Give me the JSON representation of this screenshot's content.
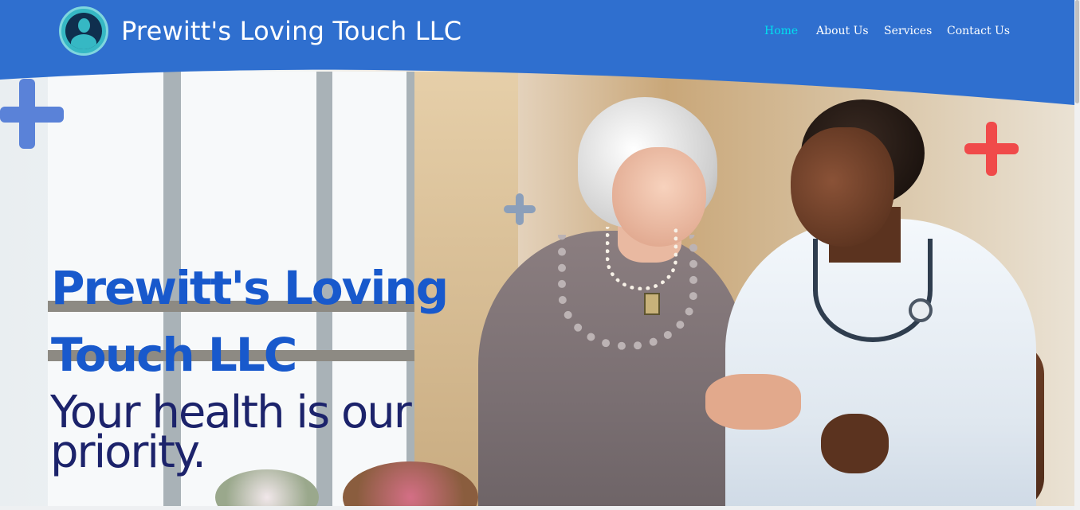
{
  "brand": {
    "name": "Prewitt's Loving Touch LLC",
    "logo_icon": "doctor-avatar-icon"
  },
  "nav": {
    "items": [
      {
        "label": "Home",
        "active": true
      },
      {
        "label": "About Us",
        "active": false
      },
      {
        "label": "Services",
        "active": false
      },
      {
        "label": "Contact Us",
        "active": false
      }
    ]
  },
  "hero": {
    "title_line1": "Prewitt's Loving",
    "title_line2": "Touch LLC",
    "tagline_line1": "Your health is our",
    "tagline_line2": "priority.",
    "image": "elderly-woman-and-nurse-photo"
  },
  "colors": {
    "header_blue": "#2f6fcf",
    "nav_active": "#00e0ef",
    "title_blue": "#1859cc",
    "tagline_navy": "#1c236b",
    "plus_blue": "#5a82d8",
    "plus_gray": "#8b9fba",
    "plus_red": "#f04a4a"
  }
}
